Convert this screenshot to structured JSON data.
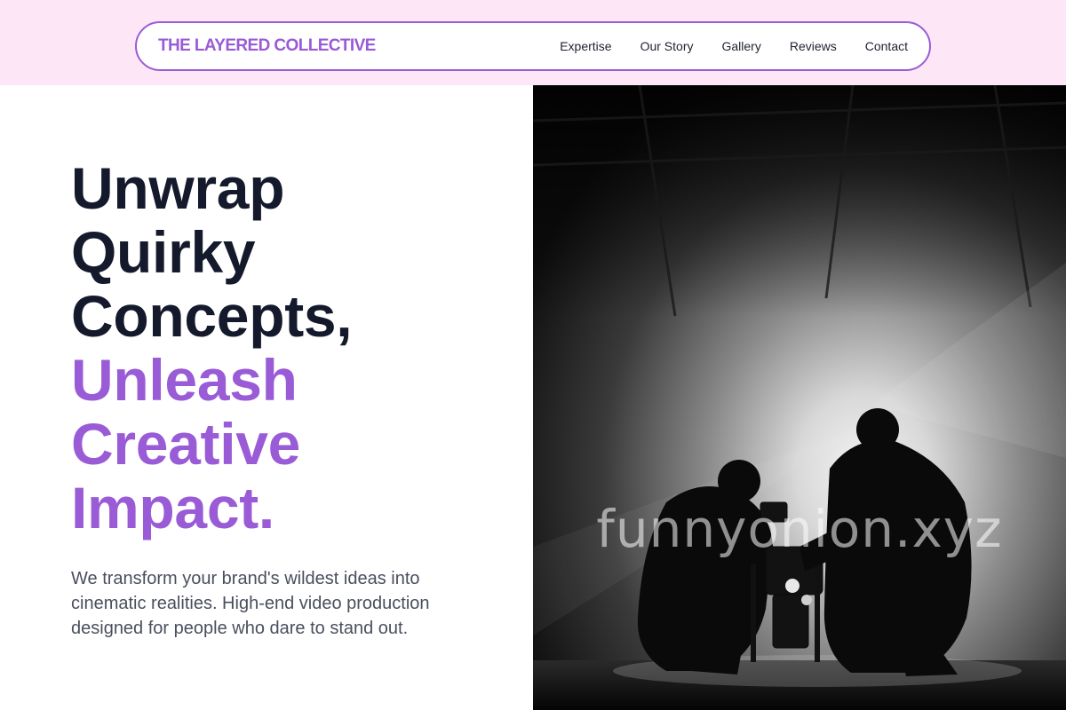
{
  "header": {
    "brand": "THE LAYERED COLLECTIVE",
    "nav": [
      {
        "label": "Expertise"
      },
      {
        "label": "Our Story"
      },
      {
        "label": "Gallery"
      },
      {
        "label": "Reviews"
      },
      {
        "label": "Contact"
      }
    ]
  },
  "hero": {
    "headline_dark": [
      "Unwrap",
      "Quirky",
      "Concepts,"
    ],
    "headline_accent": [
      "Unleash",
      "Creative",
      "Impact."
    ],
    "subtext": "We transform your brand's wildest ideas into cinematic realities. High-end video production designed for people who dare to stand out.",
    "image": {
      "subject": "film-crew-silhouette-photo",
      "watermark": "funnyonion.xyz"
    }
  },
  "colors": {
    "accent": "#9a5bd6",
    "header_band": "#fde7f6",
    "headline_dark": "#141a2c",
    "body_text": "#4a4f5e"
  }
}
